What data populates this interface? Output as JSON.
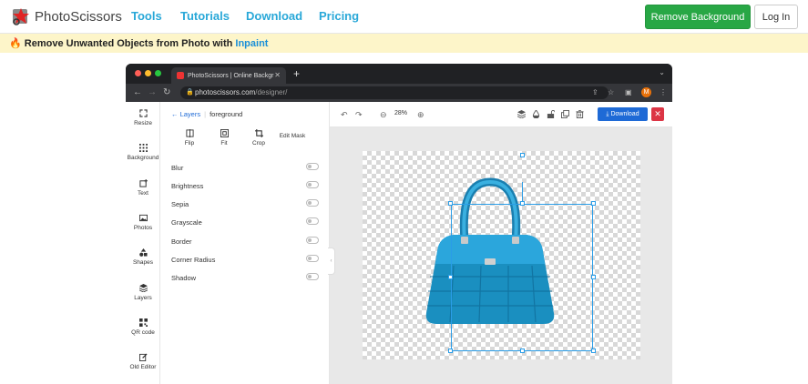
{
  "site": {
    "brand": "PhotoScissors",
    "nav": [
      "Tools",
      "Tutorials",
      "Download",
      "Pricing"
    ],
    "cta_remove": "Remove Background",
    "cta_login": "Log In"
  },
  "promo": {
    "emoji": "🔥",
    "text": "Remove Unwanted Objects from Photo with ",
    "link": "Inpaint"
  },
  "browser": {
    "tab_title": "PhotoScissors | Online Backgr",
    "url_host": "photoscissors.com",
    "url_path": "/designer/",
    "avatar_letter": "M"
  },
  "sidebar": {
    "items": [
      "Resize",
      "Background",
      "Text",
      "Photos",
      "Shapes",
      "Layers",
      "QR code",
      "Old Editor"
    ]
  },
  "panel": {
    "back_label": "Layers",
    "current": "foreground",
    "tools": [
      "Flip",
      "Fit",
      "Crop",
      "Edit Mask"
    ],
    "options": [
      "Blur",
      "Brightness",
      "Sepia",
      "Grayscale",
      "Border",
      "Corner Radius",
      "Shadow"
    ]
  },
  "toolbar": {
    "zoom": "28%",
    "download": "Download"
  },
  "colors": {
    "accent_blue": "#1e6ad6",
    "nav_link": "#29a8d8",
    "green": "#28a745",
    "red": "#dc3545",
    "bag_blue": "#1a8fc0"
  }
}
